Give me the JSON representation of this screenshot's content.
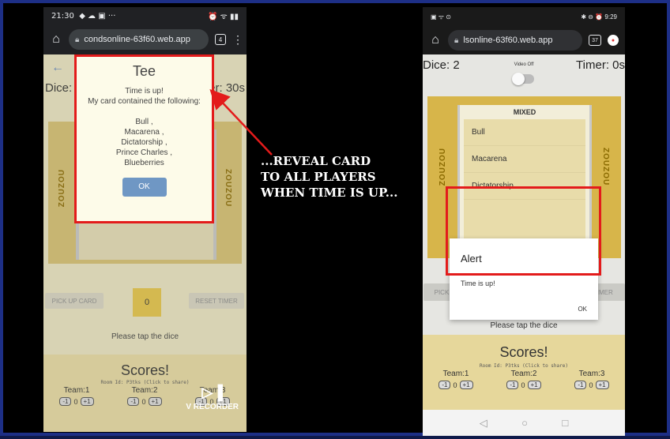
{
  "left_phone": {
    "status": {
      "time": "21:30",
      "left_icons": "◆ ☁ ▣ ···",
      "right_icons": "⏰ ᯤ ▮▮"
    },
    "address": {
      "url": "condsonline-63f60.web.app",
      "tabs": "4"
    },
    "page": {
      "dice": "Dice: 2",
      "timer": "er: 30s",
      "left_name": "ZOUZOU",
      "right_name": "ZOUZOU",
      "pick_up": "PICK UP CARD",
      "reset": "RESET TIMER",
      "dice_value": "0",
      "tap": "Please tap the dice",
      "scores_title": "Scores!",
      "room_id": "Room Id: P3tks (Click to share)",
      "teams": [
        {
          "name": "Team:1",
          "minus": "-1",
          "score": "0",
          "plus": "+1"
        },
        {
          "name": "Team:2",
          "minus": "-1",
          "score": "0",
          "plus": "+1"
        },
        {
          "name": "Team:3",
          "minus": "-1",
          "score": "0",
          "plus": "+1"
        }
      ]
    },
    "dialog": {
      "title": "Tee",
      "body": "Time is up!\nMy card contained the following:\n\nBull ,\nMacarena ,\nDictatorship ,\nPrince Charles ,\nBlueberries",
      "ok": "OK"
    },
    "recorder": "V RECORDER"
  },
  "caption": {
    "line1": "...REVEAL CARD",
    "line2": "TO ALL PLAYERS",
    "line3": "WHEN TIME IS UP..."
  },
  "right_phone": {
    "status": {
      "left_icons": "▣ ᯤ ⊙",
      "right_icons": "✱ ⊖ ⏰",
      "time": "9:29"
    },
    "address": {
      "url": "lsonline-63f60.web.app",
      "tabs": "37"
    },
    "page": {
      "dice": "Dice: 2",
      "video": "Video Off",
      "timer": "Timer: 0s",
      "card_title": "MIXED",
      "card_items": [
        "Bull",
        "Macarena",
        "Dictatorship"
      ],
      "left_name": "ZOUZOU",
      "right_name": "ZOUZOU",
      "pick_up": "PICK UP CARD",
      "reset": "RESET TIMER",
      "tap": "Please tap the dice",
      "scores_title": "Scores!",
      "room_id": "Room Id: P3tks (Click to share)",
      "teams": [
        {
          "name": "Team:1",
          "minus": "-1",
          "score": "0",
          "plus": "+1"
        },
        {
          "name": "Team:2",
          "minus": "-1",
          "score": "0",
          "plus": "+1"
        },
        {
          "name": "Team:3",
          "minus": "-1",
          "score": "0",
          "plus": "+1"
        }
      ]
    },
    "alert": {
      "title": "Alert",
      "message": "Time is up!",
      "ok": "OK"
    },
    "nav": {
      "back": "◁",
      "home": "○",
      "recents": "□"
    }
  },
  "colors": {
    "highlight": "#e31b1b",
    "frame": "#1d2f86",
    "ok_button": "#6f97c4",
    "card_gold": "#d7c173"
  }
}
